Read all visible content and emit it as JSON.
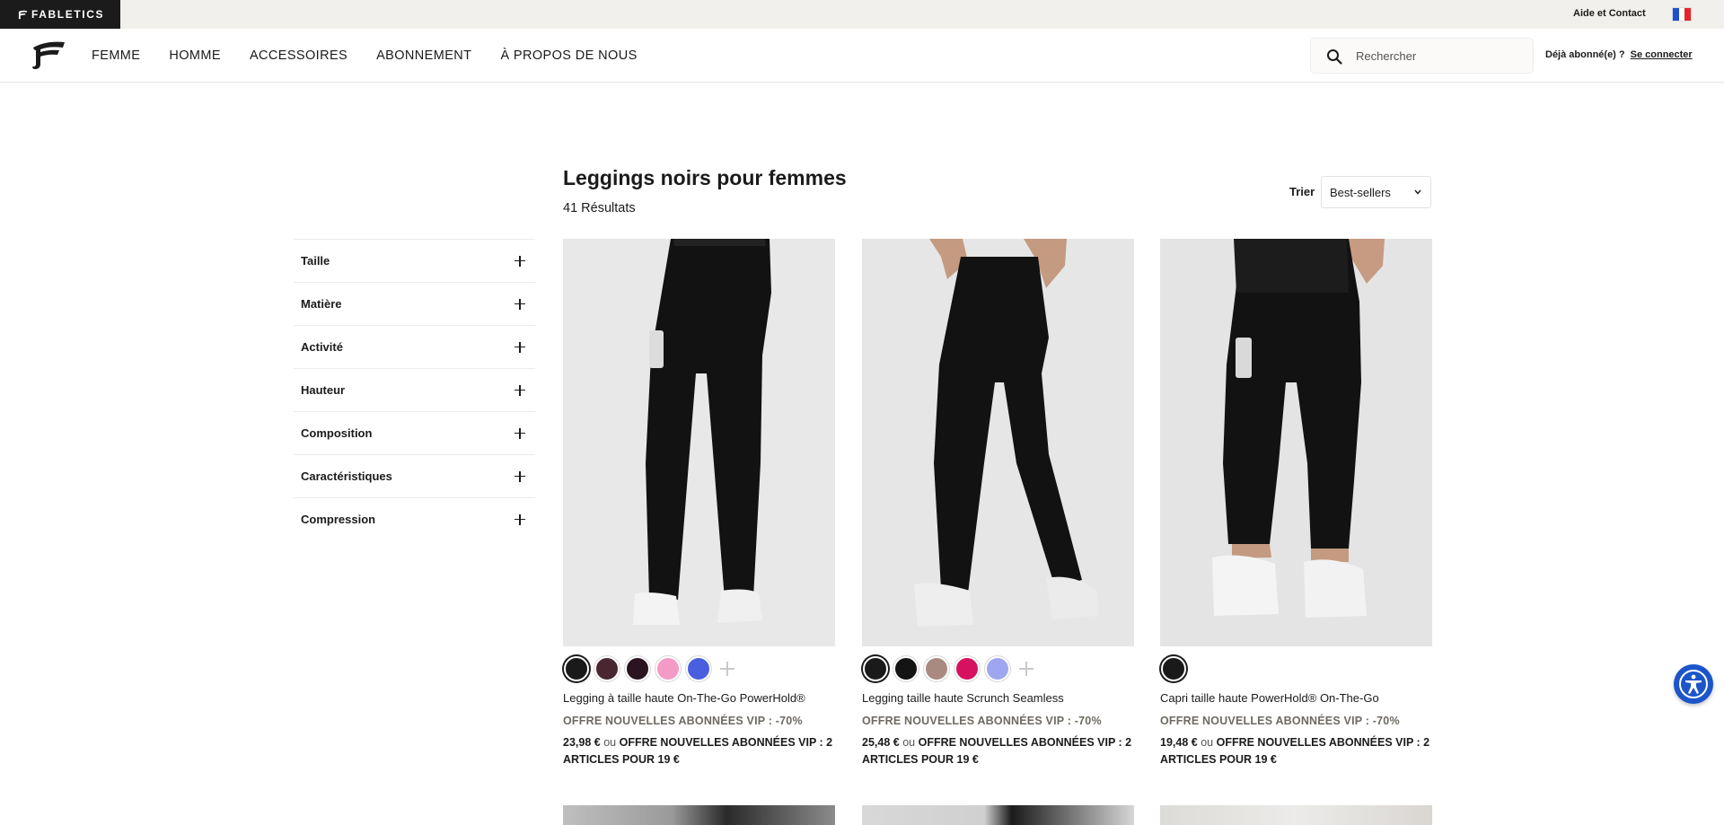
{
  "topbar": {
    "brand": "FABLETICS",
    "help_link": "Aide et Contact",
    "locale_flag": "france-flag-icon",
    "flag_colors": [
      "#1f4fd1",
      "#ffffff",
      "#e4262f"
    ]
  },
  "nav": {
    "logo": "fabletics-logo-icon",
    "links": [
      "FEMME",
      "HOMME",
      "ACCESSOIRES",
      "ABONNEMENT",
      "À PROPOS DE NOUS"
    ],
    "search_placeholder": "Rechercher",
    "account_question": "Déjà abonné(e) ?",
    "login_link": "Se connecter"
  },
  "listing": {
    "title": "Leggings noirs pour femmes",
    "result_count": "41 Résultats",
    "sort_label": "Trier",
    "sort_value": "Best-sellers"
  },
  "filters": [
    "Taille",
    "Matière",
    "Activité",
    "Hauteur",
    "Composition",
    "Caractéristiques",
    "Compression"
  ],
  "products": [
    {
      "name": "Legging à taille haute On-The-Go PowerHold®",
      "promo": "OFFRE NOUVELLES ABONNÉES VIP : -70%",
      "price": "23,98 €",
      "or": "ou",
      "vip_offer": "OFFRE NOUVELLES ABONNÉES VIP : 2 ARTICLES POUR 19 €",
      "swatches": [
        "#1a1a1a",
        "#4a2630",
        "#2a1420",
        "#f39ac6",
        "#4a5fe0"
      ],
      "more_colors": true
    },
    {
      "name": "Legging taille haute Scrunch Seamless",
      "promo": "OFFRE NOUVELLES ABONNÉES VIP : -70%",
      "price": "25,48 €",
      "or": "ou",
      "vip_offer": "OFFRE NOUVELLES ABONNÉES VIP : 2 ARTICLES POUR 19 €",
      "swatches": [
        "#1a1a1a",
        "#141414",
        "#a88a80",
        "#d6115f",
        "#9fa6f0"
      ],
      "more_colors": true
    },
    {
      "name": "Capri taille haute PowerHold® On-The-Go",
      "promo": "OFFRE NOUVELLES ABONNÉES VIP : -70%",
      "price": "19,48 €",
      "or": "ou",
      "vip_offer": "OFFRE NOUVELLES ABONNÉES VIP : 2 ARTICLES POUR 19 €",
      "swatches": [
        "#1a1a1a"
      ],
      "more_colors": false
    }
  ],
  "accessibility_button": "accessibility-icon"
}
